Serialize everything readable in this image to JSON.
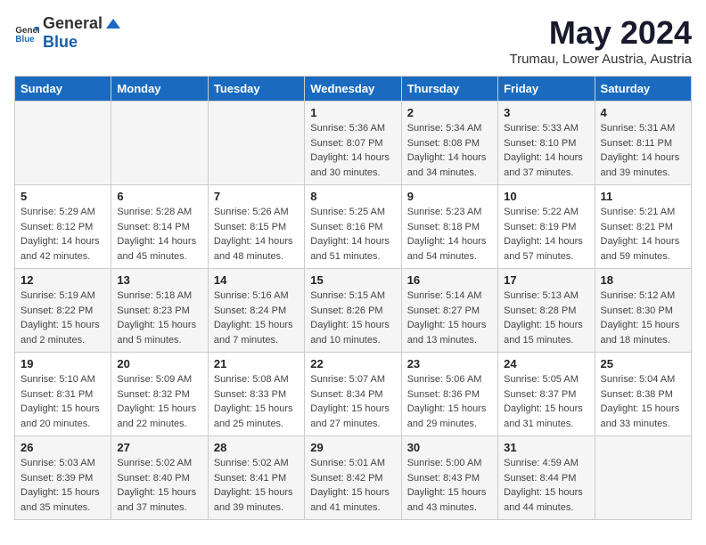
{
  "header": {
    "logo_general": "General",
    "logo_blue": "Blue",
    "month_year": "May 2024",
    "location": "Trumau, Lower Austria, Austria"
  },
  "weekdays": [
    "Sunday",
    "Monday",
    "Tuesday",
    "Wednesday",
    "Thursday",
    "Friday",
    "Saturday"
  ],
  "weeks": [
    [
      {
        "day": "",
        "info": ""
      },
      {
        "day": "",
        "info": ""
      },
      {
        "day": "",
        "info": ""
      },
      {
        "day": "1",
        "info": "Sunrise: 5:36 AM\nSunset: 8:07 PM\nDaylight: 14 hours\nand 30 minutes."
      },
      {
        "day": "2",
        "info": "Sunrise: 5:34 AM\nSunset: 8:08 PM\nDaylight: 14 hours\nand 34 minutes."
      },
      {
        "day": "3",
        "info": "Sunrise: 5:33 AM\nSunset: 8:10 PM\nDaylight: 14 hours\nand 37 minutes."
      },
      {
        "day": "4",
        "info": "Sunrise: 5:31 AM\nSunset: 8:11 PM\nDaylight: 14 hours\nand 39 minutes."
      }
    ],
    [
      {
        "day": "5",
        "info": "Sunrise: 5:29 AM\nSunset: 8:12 PM\nDaylight: 14 hours\nand 42 minutes."
      },
      {
        "day": "6",
        "info": "Sunrise: 5:28 AM\nSunset: 8:14 PM\nDaylight: 14 hours\nand 45 minutes."
      },
      {
        "day": "7",
        "info": "Sunrise: 5:26 AM\nSunset: 8:15 PM\nDaylight: 14 hours\nand 48 minutes."
      },
      {
        "day": "8",
        "info": "Sunrise: 5:25 AM\nSunset: 8:16 PM\nDaylight: 14 hours\nand 51 minutes."
      },
      {
        "day": "9",
        "info": "Sunrise: 5:23 AM\nSunset: 8:18 PM\nDaylight: 14 hours\nand 54 minutes."
      },
      {
        "day": "10",
        "info": "Sunrise: 5:22 AM\nSunset: 8:19 PM\nDaylight: 14 hours\nand 57 minutes."
      },
      {
        "day": "11",
        "info": "Sunrise: 5:21 AM\nSunset: 8:21 PM\nDaylight: 14 hours\nand 59 minutes."
      }
    ],
    [
      {
        "day": "12",
        "info": "Sunrise: 5:19 AM\nSunset: 8:22 PM\nDaylight: 15 hours\nand 2 minutes."
      },
      {
        "day": "13",
        "info": "Sunrise: 5:18 AM\nSunset: 8:23 PM\nDaylight: 15 hours\nand 5 minutes."
      },
      {
        "day": "14",
        "info": "Sunrise: 5:16 AM\nSunset: 8:24 PM\nDaylight: 15 hours\nand 7 minutes."
      },
      {
        "day": "15",
        "info": "Sunrise: 5:15 AM\nSunset: 8:26 PM\nDaylight: 15 hours\nand 10 minutes."
      },
      {
        "day": "16",
        "info": "Sunrise: 5:14 AM\nSunset: 8:27 PM\nDaylight: 15 hours\nand 13 minutes."
      },
      {
        "day": "17",
        "info": "Sunrise: 5:13 AM\nSunset: 8:28 PM\nDaylight: 15 hours\nand 15 minutes."
      },
      {
        "day": "18",
        "info": "Sunrise: 5:12 AM\nSunset: 8:30 PM\nDaylight: 15 hours\nand 18 minutes."
      }
    ],
    [
      {
        "day": "19",
        "info": "Sunrise: 5:10 AM\nSunset: 8:31 PM\nDaylight: 15 hours\nand 20 minutes."
      },
      {
        "day": "20",
        "info": "Sunrise: 5:09 AM\nSunset: 8:32 PM\nDaylight: 15 hours\nand 22 minutes."
      },
      {
        "day": "21",
        "info": "Sunrise: 5:08 AM\nSunset: 8:33 PM\nDaylight: 15 hours\nand 25 minutes."
      },
      {
        "day": "22",
        "info": "Sunrise: 5:07 AM\nSunset: 8:34 PM\nDaylight: 15 hours\nand 27 minutes."
      },
      {
        "day": "23",
        "info": "Sunrise: 5:06 AM\nSunset: 8:36 PM\nDaylight: 15 hours\nand 29 minutes."
      },
      {
        "day": "24",
        "info": "Sunrise: 5:05 AM\nSunset: 8:37 PM\nDaylight: 15 hours\nand 31 minutes."
      },
      {
        "day": "25",
        "info": "Sunrise: 5:04 AM\nSunset: 8:38 PM\nDaylight: 15 hours\nand 33 minutes."
      }
    ],
    [
      {
        "day": "26",
        "info": "Sunrise: 5:03 AM\nSunset: 8:39 PM\nDaylight: 15 hours\nand 35 minutes."
      },
      {
        "day": "27",
        "info": "Sunrise: 5:02 AM\nSunset: 8:40 PM\nDaylight: 15 hours\nand 37 minutes."
      },
      {
        "day": "28",
        "info": "Sunrise: 5:02 AM\nSunset: 8:41 PM\nDaylight: 15 hours\nand 39 minutes."
      },
      {
        "day": "29",
        "info": "Sunrise: 5:01 AM\nSunset: 8:42 PM\nDaylight: 15 hours\nand 41 minutes."
      },
      {
        "day": "30",
        "info": "Sunrise: 5:00 AM\nSunset: 8:43 PM\nDaylight: 15 hours\nand 43 minutes."
      },
      {
        "day": "31",
        "info": "Sunrise: 4:59 AM\nSunset: 8:44 PM\nDaylight: 15 hours\nand 44 minutes."
      },
      {
        "day": "",
        "info": ""
      }
    ]
  ]
}
